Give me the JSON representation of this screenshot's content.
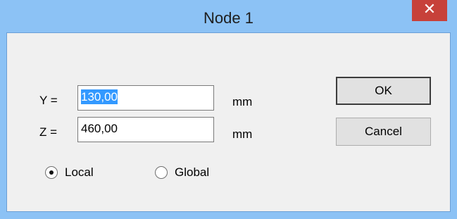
{
  "window": {
    "title": "Node 1",
    "close_glyph": "✕"
  },
  "form": {
    "y_label": "Y =",
    "y_value": "130,00",
    "y_unit": "mm",
    "z_label": "Z =",
    "z_value": "460,00",
    "z_unit": "mm"
  },
  "buttons": {
    "ok_label": "OK",
    "cancel_label": "Cancel"
  },
  "radios": {
    "local_label": "Local",
    "global_label": "Global",
    "selected": "local"
  },
  "colors": {
    "titlebar": "#8cc2f5",
    "close": "#c7413a",
    "selection": "#3399ff"
  },
  "icons": {
    "close": "close-icon"
  }
}
